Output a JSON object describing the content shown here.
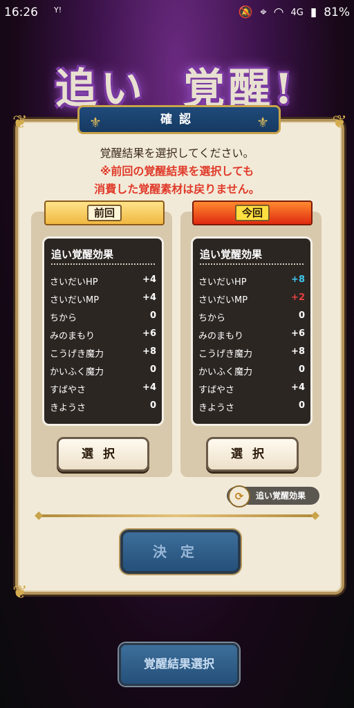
{
  "status_bar": {
    "time": "16:26",
    "sim_label": "Y!",
    "network": "4G",
    "battery": "81%"
  },
  "screen_title": {
    "part1": "追い",
    "part2": "覚醒!"
  },
  "dialog": {
    "header": "確認",
    "message": "覚醒結果を選択してください。",
    "warning_line1": "※前回の覚醒結果を選択しても",
    "warning_line2": "消費した覚醒素材は戻りません。"
  },
  "previous": {
    "ribbon": "前回",
    "panel_title": "追い覚醒効果",
    "stats": [
      {
        "name": "さいだいHP",
        "value": "+4"
      },
      {
        "name": "さいだいMP",
        "value": "+4"
      },
      {
        "name": "ちから",
        "value": "0"
      },
      {
        "name": "みのまもり",
        "value": "+6"
      },
      {
        "name": "こうげき魔力",
        "value": "+8"
      },
      {
        "name": "かいふく魔力",
        "value": "0"
      },
      {
        "name": "すばやさ",
        "value": "+4"
      },
      {
        "name": "きようさ",
        "value": "0"
      }
    ],
    "select_button": "選択"
  },
  "current": {
    "ribbon": "今回",
    "panel_title": "追い覚醒効果",
    "stats": [
      {
        "name": "さいだいHP",
        "value": "+8",
        "color": "#3ec8f0"
      },
      {
        "name": "さいだいMP",
        "value": "+2",
        "color": "#e84040"
      },
      {
        "name": "ちから",
        "value": "0"
      },
      {
        "name": "みのまもり",
        "value": "+6"
      },
      {
        "name": "こうげき魔力",
        "value": "+8"
      },
      {
        "name": "かいふく魔力",
        "value": "0"
      },
      {
        "name": "すばやさ",
        "value": "+4"
      },
      {
        "name": "きようさ",
        "value": "0"
      }
    ],
    "select_button": "選択"
  },
  "toggle_label": "追い覚醒効果",
  "decide_button": "決定",
  "bottom_button": "覚醒結果選択",
  "colors": {
    "accent_gold": "#c9a44a",
    "header_blue": "#1f4a7a",
    "warning_red": "#e03a2a",
    "increase_cyan": "#3ec8f0",
    "decrease_red": "#e84040"
  }
}
